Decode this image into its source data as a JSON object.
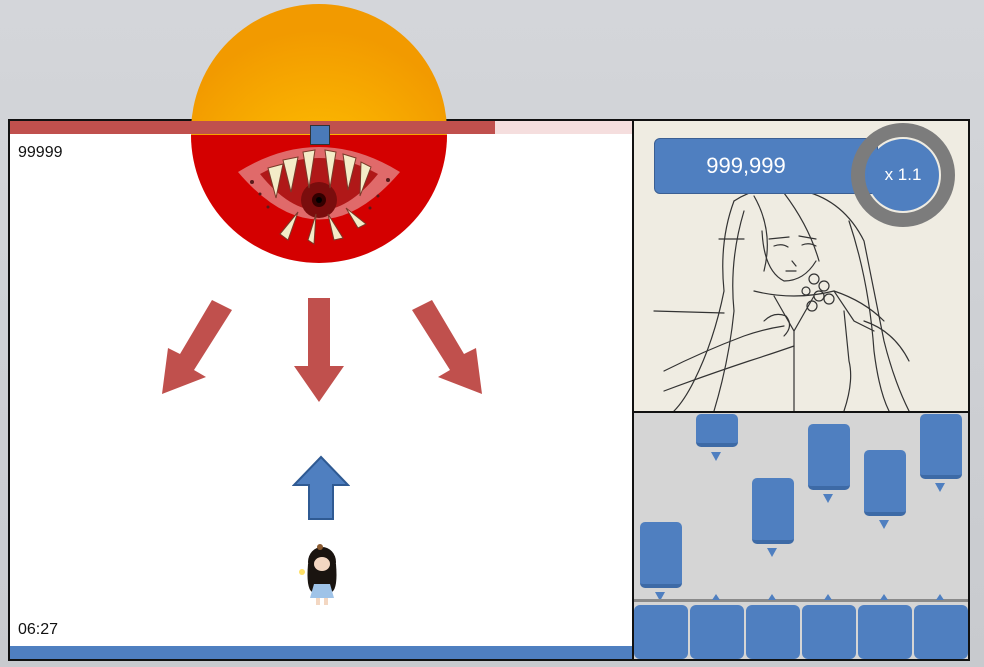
{
  "game": {
    "score": "99999",
    "timer": "06:27",
    "boss_health_fraction": 0.78,
    "boss_health_remaining_fraction": 0.22
  },
  "side": {
    "total_score": "999,999",
    "multiplier": "x 1.1",
    "multiplier_ring_fraction": 0.85
  },
  "lanes": {
    "count": 6,
    "notes_visible": 6
  },
  "colors": {
    "health_red": "#c0504d",
    "accent_blue": "#4f7fc0",
    "boss_red": "#d40000",
    "sun_orange": "#f5a000"
  },
  "icons": {
    "attack_arrows": "arrow-down-icon",
    "player_arrow": "arrow-up-icon"
  }
}
